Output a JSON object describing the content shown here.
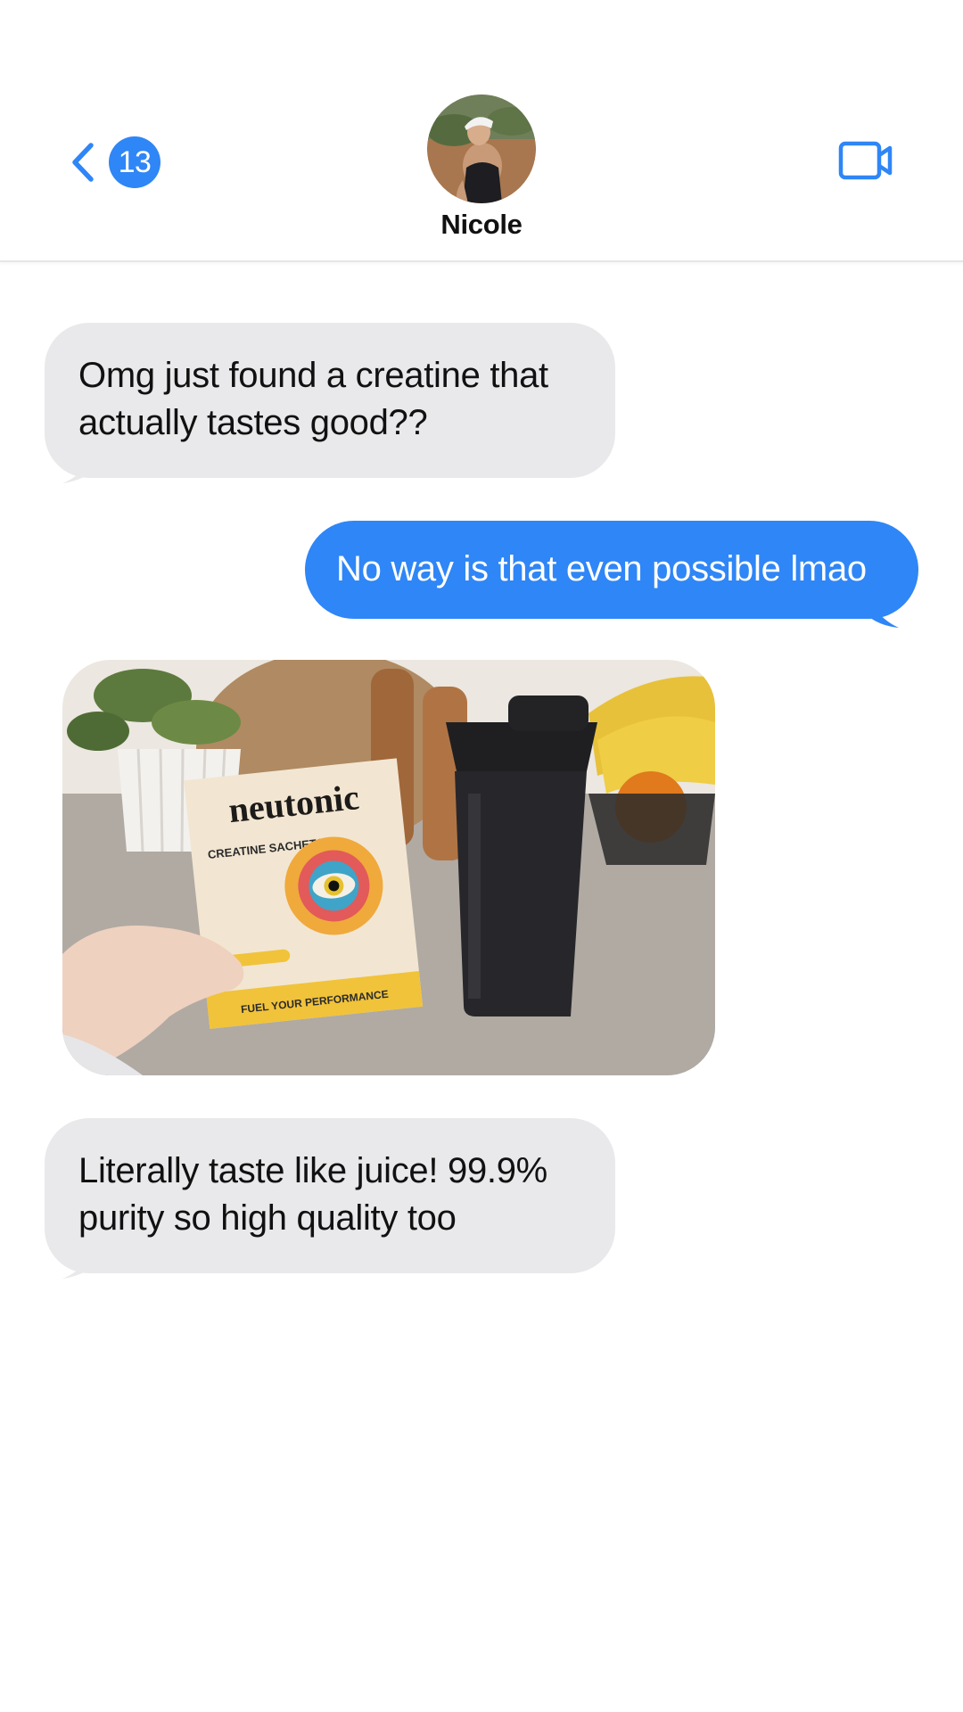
{
  "header": {
    "back_icon": "chevron-left-icon",
    "unread_count": "13",
    "contact_name": "Nicole",
    "video_icon": "video-camera-icon"
  },
  "messages": [
    {
      "direction": "incoming",
      "text": "Omg just found a creatine that\nactually tastes good??"
    },
    {
      "direction": "outgoing",
      "text": "No way is that even possible lmao"
    },
    {
      "direction": "incoming",
      "type": "photo",
      "photo": {
        "brand": "neutonic",
        "product": "CREATINE SACHETS",
        "tagline": "FUEL YOUR PERFORMANCE"
      }
    },
    {
      "direction": "incoming",
      "text": "Literally taste like juice! 99.9%\npurity so high quality too"
    }
  ],
  "colors": {
    "accent": "#2f86f6",
    "incoming_bubble": "#e9e9eb",
    "outgoing_bubble": "#2f86f6",
    "background": "#ffffff"
  }
}
